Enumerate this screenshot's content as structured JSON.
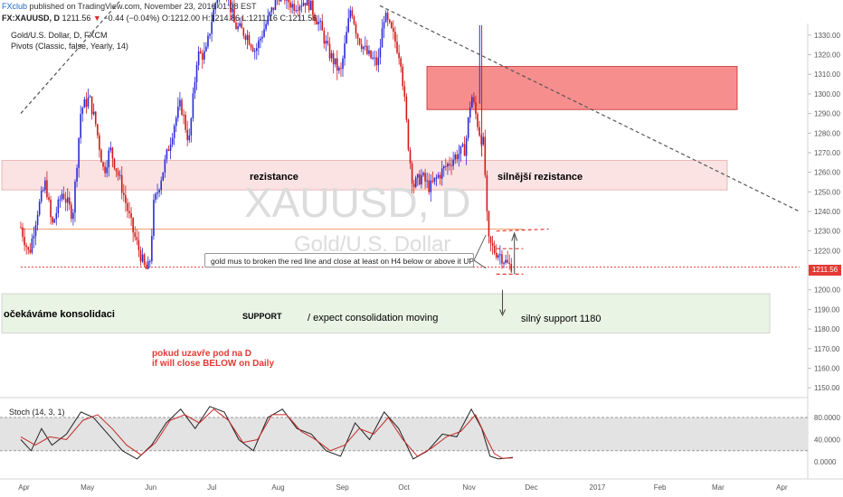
{
  "header": {
    "brand": "FXclub",
    "published": "published on TradingView.com, November 23, 2016 01:08 EST",
    "symbol": "FX:XAUUSD, D",
    "last": "1211.56",
    "change": "−0.44 (−0.04%)",
    "open": "O:1212.00",
    "high": "H:1214.86",
    "low": "L:1211.16",
    "close": "C:1211.56"
  },
  "legend": {
    "title": "Gold/U.S. Dollar, D, FXCM",
    "indicator": "Pivots (Classic, false, Yearly, 14)"
  },
  "watermark": {
    "big": "XAUUSD, D",
    "small": "Gold/U.S. Dollar"
  },
  "annotations": {
    "resistance": "rezistance",
    "strong_resistance": "silnější rezistance",
    "consolidation_cz": "očekáváme konsolidaci",
    "support": "SUPPORT",
    "consolidation_en": "/ expect consolidation moving",
    "strong_support": "silný support 1180",
    "close_below_cz": "pokud uzavře pod na D",
    "close_below_en": "if will close BELOW on Daily",
    "callout": "gold mus to broken the red line and close at least on H4 below or above it UP"
  },
  "price_box": "1211.56",
  "stoch_label": "Stoch (14, 3, 1)",
  "colors": {
    "bull": "#2b2bd6",
    "bear": "#d11a1a",
    "resistance_zone": "#fbe3e3",
    "strong_zone": "#f47a7a",
    "support_zone": "#e9f4e5",
    "stoch_band": "#e3e3e3",
    "stoch_k": "#222222",
    "stoch_d": "#c62828",
    "price_box": "#e53935"
  },
  "chart_data": {
    "type": "candlestick",
    "symbol": "XAUUSD",
    "timeframe": "D",
    "x_labels": [
      "Apr",
      "May",
      "Jun",
      "Jul",
      "Aug",
      "Sep",
      "Oct",
      "Nov",
      "Dec",
      "2017",
      "Feb",
      "Mar",
      "Apr"
    ],
    "y_ticks": [
      1150,
      1160,
      1170,
      1180,
      1190,
      1200,
      1210,
      1220,
      1230,
      1240,
      1250,
      1260,
      1270,
      1280,
      1290,
      1300,
      1310,
      1320,
      1330
    ],
    "ylim": [
      1145,
      1335
    ],
    "last_price": 1211.56,
    "zones": [
      {
        "label": "rezistance",
        "from": 1251,
        "to": 1266
      },
      {
        "label": "silnější rezistance",
        "from": 1292,
        "to": 1314
      },
      {
        "label": "SUPPORT",
        "from": 1178,
        "to": 1198
      }
    ],
    "path_points": [
      [
        "2016-03-31",
        1232
      ],
      [
        "2016-04-04",
        1218
      ],
      [
        "2016-04-08",
        1240
      ],
      [
        "2016-04-12",
        1255
      ],
      [
        "2016-04-15",
        1232
      ],
      [
        "2016-04-20",
        1250
      ],
      [
        "2016-04-25",
        1238
      ],
      [
        "2016-04-29",
        1292
      ],
      [
        "2016-05-03",
        1298
      ],
      [
        "2016-05-06",
        1285
      ],
      [
        "2016-05-10",
        1260
      ],
      [
        "2016-05-13",
        1272
      ],
      [
        "2016-05-18",
        1255
      ],
      [
        "2016-05-24",
        1230
      ],
      [
        "2016-05-30",
        1210
      ],
      [
        "2016-06-01",
        1212
      ],
      [
        "2016-06-03",
        1243
      ],
      [
        "2016-06-08",
        1263
      ],
      [
        "2016-06-13",
        1285
      ],
      [
        "2016-06-16",
        1295
      ],
      [
        "2016-06-20",
        1275
      ],
      [
        "2016-06-24",
        1320
      ],
      [
        "2016-06-28",
        1320
      ],
      [
        "2016-07-01",
        1338
      ],
      [
        "2016-07-06",
        1362
      ],
      [
        "2016-07-12",
        1335
      ],
      [
        "2016-07-18",
        1330
      ],
      [
        "2016-07-22",
        1322
      ],
      [
        "2016-07-28",
        1338
      ],
      [
        "2016-08-03",
        1352
      ],
      [
        "2016-08-09",
        1345
      ],
      [
        "2016-08-16",
        1348
      ],
      [
        "2016-08-22",
        1335
      ],
      [
        "2016-08-26",
        1322
      ],
      [
        "2016-09-01",
        1310
      ],
      [
        "2016-09-06",
        1345
      ],
      [
        "2016-09-09",
        1330
      ],
      [
        "2016-09-14",
        1320
      ],
      [
        "2016-09-19",
        1315
      ],
      [
        "2016-09-22",
        1340
      ],
      [
        "2016-09-27",
        1328
      ],
      [
        "2016-09-30",
        1318
      ],
      [
        "2016-10-04",
        1270
      ],
      [
        "2016-10-06",
        1253
      ],
      [
        "2016-10-10",
        1258
      ],
      [
        "2016-10-14",
        1252
      ],
      [
        "2016-10-18",
        1258
      ],
      [
        "2016-10-21",
        1262
      ],
      [
        "2016-10-26",
        1268
      ],
      [
        "2016-10-31",
        1272
      ],
      [
        "2016-11-03",
        1300
      ],
      [
        "2016-11-07",
        1280
      ],
      [
        "2016-11-09",
        1274
      ],
      [
        "2016-11-11",
        1225
      ],
      [
        "2016-11-14",
        1220
      ],
      [
        "2016-11-17",
        1218
      ],
      [
        "2016-11-21",
        1212
      ],
      [
        "2016-11-22",
        1213
      ],
      [
        "2016-11-23",
        1211.56
      ]
    ],
    "resistance_line": {
      "x1": "2016-03-31",
      "y1": 1290,
      "x2": "2016-06-18",
      "y2": 1385
    },
    "downtrend_line": {
      "x1": "2016-09-20",
      "y1": 1345,
      "x2": "2017-04-10",
      "y2": 1240
    },
    "levels": [
      {
        "name": "orange",
        "value": 1231,
        "from": "2016-03-31",
        "to": "2016-11-28"
      },
      {
        "name": "red-dotted",
        "value": 1211.56,
        "from": "2016-03-31",
        "to": "2017-04-10"
      }
    ],
    "stoch": {
      "label": "Stoch (14, 3, 1)",
      "ticks": [
        0,
        40,
        80
      ],
      "tick_labels": [
        "0.0000",
        "40.0000",
        "80.0000"
      ],
      "band": [
        20,
        80
      ],
      "k": [
        [
          "2016-03-31",
          40
        ],
        [
          "2016-04-05",
          20
        ],
        [
          "2016-04-10",
          60
        ],
        [
          "2016-04-15",
          30
        ],
        [
          "2016-04-22",
          50
        ],
        [
          "2016-04-29",
          90
        ],
        [
          "2016-05-05",
          80
        ],
        [
          "2016-05-12",
          50
        ],
        [
          "2016-05-19",
          20
        ],
        [
          "2016-05-26",
          5
        ],
        [
          "2016-06-02",
          30
        ],
        [
          "2016-06-09",
          70
        ],
        [
          "2016-06-16",
          95
        ],
        [
          "2016-06-23",
          60
        ],
        [
          "2016-06-30",
          100
        ],
        [
          "2016-07-07",
          90
        ],
        [
          "2016-07-14",
          40
        ],
        [
          "2016-07-21",
          20
        ],
        [
          "2016-07-28",
          80
        ],
        [
          "2016-08-04",
          95
        ],
        [
          "2016-08-11",
          60
        ],
        [
          "2016-08-18",
          50
        ],
        [
          "2016-08-25",
          20
        ],
        [
          "2016-09-01",
          10
        ],
        [
          "2016-09-08",
          70
        ],
        [
          "2016-09-15",
          40
        ],
        [
          "2016-09-22",
          90
        ],
        [
          "2016-09-29",
          60
        ],
        [
          "2016-10-06",
          5
        ],
        [
          "2016-10-13",
          20
        ],
        [
          "2016-10-20",
          50
        ],
        [
          "2016-10-27",
          45
        ],
        [
          "2016-11-03",
          95
        ],
        [
          "2016-11-08",
          60
        ],
        [
          "2016-11-12",
          10
        ],
        [
          "2016-11-16",
          5
        ],
        [
          "2016-11-23",
          8
        ]
      ],
      "d": [
        [
          "2016-03-31",
          45
        ],
        [
          "2016-04-07",
          30
        ],
        [
          "2016-04-14",
          45
        ],
        [
          "2016-04-22",
          40
        ],
        [
          "2016-04-30",
          75
        ],
        [
          "2016-05-07",
          85
        ],
        [
          "2016-05-14",
          60
        ],
        [
          "2016-05-21",
          30
        ],
        [
          "2016-05-28",
          12
        ],
        [
          "2016-06-04",
          35
        ],
        [
          "2016-06-11",
          75
        ],
        [
          "2016-06-18",
          85
        ],
        [
          "2016-06-25",
          70
        ],
        [
          "2016-07-02",
          95
        ],
        [
          "2016-07-09",
          75
        ],
        [
          "2016-07-16",
          35
        ],
        [
          "2016-07-23",
          40
        ],
        [
          "2016-07-30",
          85
        ],
        [
          "2016-08-06",
          85
        ],
        [
          "2016-08-13",
          55
        ],
        [
          "2016-08-20",
          40
        ],
        [
          "2016-08-27",
          20
        ],
        [
          "2016-09-03",
          30
        ],
        [
          "2016-09-10",
          60
        ],
        [
          "2016-09-17",
          50
        ],
        [
          "2016-09-24",
          80
        ],
        [
          "2016-10-01",
          40
        ],
        [
          "2016-10-08",
          10
        ],
        [
          "2016-10-15",
          25
        ],
        [
          "2016-10-22",
          45
        ],
        [
          "2016-10-29",
          55
        ],
        [
          "2016-11-05",
          85
        ],
        [
          "2016-11-10",
          45
        ],
        [
          "2016-11-14",
          15
        ],
        [
          "2016-11-18",
          6
        ],
        [
          "2016-11-23",
          7
        ]
      ]
    }
  }
}
